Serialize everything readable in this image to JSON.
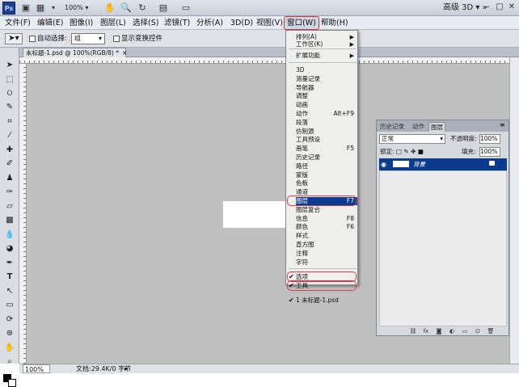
{
  "app": {
    "logo": "Ps",
    "zoom": "100%",
    "workspace": "高级 3D"
  },
  "menubar": {
    "items": [
      "文件(F)",
      "编辑(E)",
      "图像(I)",
      "图层(L)",
      "选择(S)",
      "滤镜(T)",
      "分析(A)",
      "3D(D)",
      "视图(V)",
      "窗口(W)",
      "帮助(H)"
    ]
  },
  "options": {
    "auto_select_label": "自动选择:",
    "auto_select_value": "组",
    "show_transform_label": "显示变换控件"
  },
  "document": {
    "tab_title": "未标题-1.psd @ 100%(RGB/8) *"
  },
  "status": {
    "zoom": "100%",
    "doc_info": "文档:29.4K/0 字节"
  },
  "window_menu": {
    "top_items": [
      {
        "label": "排列(A)",
        "has_submenu": true
      },
      {
        "label": "工作区(K)",
        "has_submenu": true
      },
      {
        "label": "扩展功能",
        "has_submenu": true
      }
    ],
    "panel_items": [
      {
        "label": "3D",
        "shortcut": ""
      },
      {
        "label": "测量记录",
        "shortcut": ""
      },
      {
        "label": "导航器",
        "shortcut": ""
      },
      {
        "label": "调整",
        "shortcut": ""
      },
      {
        "label": "动画",
        "shortcut": ""
      },
      {
        "label": "动作",
        "shortcut": "Alt+F9"
      },
      {
        "label": "段落",
        "shortcut": ""
      },
      {
        "label": "仿制源",
        "shortcut": ""
      },
      {
        "label": "工具预设",
        "shortcut": ""
      },
      {
        "label": "画笔",
        "shortcut": "F5"
      },
      {
        "label": "历史记录",
        "shortcut": ""
      },
      {
        "label": "路径",
        "shortcut": ""
      },
      {
        "label": "蒙版",
        "shortcut": ""
      },
      {
        "label": "色板",
        "shortcut": ""
      },
      {
        "label": "通道",
        "shortcut": ""
      },
      {
        "label": "图层",
        "shortcut": "F7"
      },
      {
        "label": "图层复合",
        "shortcut": ""
      },
      {
        "label": "信息",
        "shortcut": "F8"
      },
      {
        "label": "颜色",
        "shortcut": "F6"
      },
      {
        "label": "样式",
        "shortcut": ""
      },
      {
        "label": "直方图",
        "shortcut": ""
      },
      {
        "label": "注释",
        "shortcut": ""
      },
      {
        "label": "字符",
        "shortcut": ""
      }
    ],
    "option_items": [
      {
        "label": "选项"
      },
      {
        "label": "工具"
      }
    ],
    "doc_item": "1 未标题-1.psd",
    "checked_items": [
      "图层",
      "选项",
      "工具",
      "1 未标题-1.psd"
    ],
    "highlighted_item": "图层",
    "check_glyph": "✔"
  },
  "layers_panel": {
    "tabs": [
      "历史记录",
      "动作",
      "图层"
    ],
    "active_tab": "图层",
    "blend_mode": "正常",
    "opacity_label": "不透明度:",
    "opacity": "100%",
    "lock_label": "锁定:",
    "fill_label": "填充:",
    "fill": "100%",
    "layer_name": "背景"
  },
  "icons": {
    "eye": "eye-icon",
    "lock": "lock-icon"
  },
  "colors": {
    "accent_highlight": "#d93b46",
    "selection_blue": "#0c3a8c",
    "canvas_bg": "#c0c0c0"
  }
}
